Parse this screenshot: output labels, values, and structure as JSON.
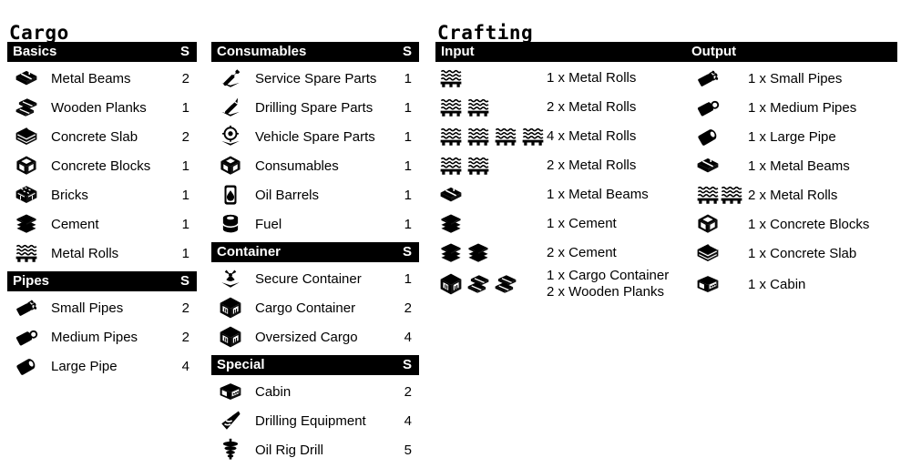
{
  "cargo": {
    "title": "Cargo",
    "columns": [
      {
        "sections": [
          {
            "header": "Basics",
            "qty_header": "S",
            "items": [
              {
                "icon": "metal-beams-icon",
                "label": "Metal Beams",
                "qty": "2"
              },
              {
                "icon": "wooden-planks-icon",
                "label": "Wooden Planks",
                "qty": "1"
              },
              {
                "icon": "concrete-slab-icon",
                "label": "Concrete Slab",
                "qty": "2"
              },
              {
                "icon": "concrete-blocks-icon",
                "label": "Concrete Blocks",
                "qty": "1"
              },
              {
                "icon": "bricks-icon",
                "label": "Bricks",
                "qty": "1"
              },
              {
                "icon": "cement-icon",
                "label": "Cement",
                "qty": "1"
              },
              {
                "icon": "metal-rolls-icon",
                "label": "Metal Rolls",
                "qty": "1"
              }
            ]
          },
          {
            "header": "Pipes",
            "qty_header": "S",
            "items": [
              {
                "icon": "small-pipes-icon",
                "label": "Small Pipes",
                "qty": "2"
              },
              {
                "icon": "medium-pipes-icon",
                "label": "Medium Pipes",
                "qty": "2"
              },
              {
                "icon": "large-pipe-icon",
                "label": "Large Pipe",
                "qty": "4"
              }
            ]
          }
        ]
      },
      {
        "sections": [
          {
            "header": "Consumables",
            "qty_header": "S",
            "items": [
              {
                "icon": "service-spare-parts-icon",
                "label": "Service Spare Parts",
                "qty": "1"
              },
              {
                "icon": "drilling-spare-parts-icon",
                "label": "Drilling Spare Parts",
                "qty": "1"
              },
              {
                "icon": "vehicle-spare-parts-icon",
                "label": "Vehicle Spare Parts",
                "qty": "1"
              },
              {
                "icon": "consumables-icon",
                "label": "Consumables",
                "qty": "1"
              },
              {
                "icon": "oil-barrels-icon",
                "label": "Oil Barrels",
                "qty": "1"
              },
              {
                "icon": "fuel-icon",
                "label": "Fuel",
                "qty": "1"
              }
            ]
          },
          {
            "header": "Container",
            "qty_header": "S",
            "items": [
              {
                "icon": "secure-container-icon",
                "label": "Secure Container",
                "qty": "1"
              },
              {
                "icon": "cargo-container-icon",
                "label": "Cargo Container",
                "qty": "2"
              },
              {
                "icon": "oversized-cargo-icon",
                "label": "Oversized Cargo",
                "qty": "4"
              }
            ]
          },
          {
            "header": "Special",
            "qty_header": "S",
            "items": [
              {
                "icon": "cabin-icon",
                "label": "Cabin",
                "qty": "2"
              },
              {
                "icon": "drilling-equipment-icon",
                "label": "Drilling Equipment",
                "qty": "4"
              },
              {
                "icon": "oil-rig-drill-icon",
                "label": "Oil Rig Drill",
                "qty": "5"
              }
            ]
          }
        ]
      }
    ]
  },
  "crafting": {
    "title": "Crafting",
    "input_header": "Input",
    "output_header": "Output",
    "recipes": [
      {
        "input_icons": [
          "metal-rolls-icon"
        ],
        "input_text": "1 x Metal Rolls",
        "output_icon": "small-pipes-icon",
        "output_text": "1 x Small Pipes"
      },
      {
        "input_icons": [
          "metal-rolls-icon",
          "metal-rolls-icon"
        ],
        "input_text": "2 x Metal Rolls",
        "output_icon": "medium-pipes-icon",
        "output_text": "1 x Medium Pipes"
      },
      {
        "input_icons": [
          "metal-rolls-icon",
          "metal-rolls-icon",
          "metal-rolls-icon",
          "metal-rolls-icon"
        ],
        "input_text": "4 x Metal Rolls",
        "output_icon": "large-pipe-icon",
        "output_text": "1 x Large Pipe"
      },
      {
        "input_icons": [
          "metal-rolls-icon",
          "metal-rolls-icon"
        ],
        "input_text": "2 x Metal Rolls",
        "output_icon": "metal-beams-icon",
        "output_text": "1 x Metal Beams"
      },
      {
        "input_icons": [
          "metal-beams-icon"
        ],
        "input_text": "1 x Metal Beams",
        "output_icon": "metal-rolls-icon",
        "output_icon_count": 2,
        "output_text": "2 x Metal Rolls"
      },
      {
        "input_icons": [
          "cement-icon"
        ],
        "input_text": "1 x Cement",
        "output_icon": "concrete-blocks-icon",
        "output_text": "1 x Concrete Blocks"
      },
      {
        "input_icons": [
          "cement-icon",
          "cement-icon"
        ],
        "input_text": "2 x Cement",
        "output_icon": "concrete-slab-icon",
        "output_text": "1 x Concrete Slab"
      },
      {
        "input_icons": [
          "cargo-container-icon",
          "wooden-planks-icon",
          "wooden-planks-icon"
        ],
        "input_text": "1 x Cargo Container\n2 x Wooden Planks",
        "output_icon": "cabin-icon",
        "output_text": "1 x Cabin"
      }
    ]
  },
  "colors": {
    "background": "#ffffff",
    "header_bar": "#000000",
    "header_text": "#ffffff",
    "body_text": "#000000"
  }
}
